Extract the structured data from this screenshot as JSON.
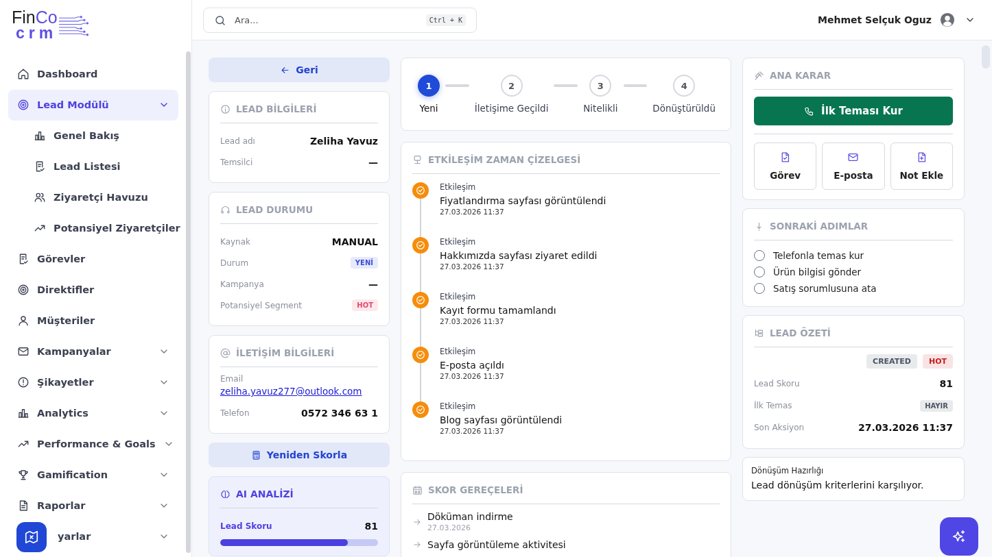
{
  "logo": {
    "dark": "Fin",
    "accent": "Co",
    "sub": "crm"
  },
  "sidebar": {
    "items": [
      {
        "label": "Dashboard",
        "selected": false,
        "expandable": false
      },
      {
        "label": "Lead Modülü",
        "selected": true,
        "expandable": true,
        "expanded": true,
        "children": [
          {
            "label": "Genel Bakış"
          },
          {
            "label": "Lead Listesi"
          },
          {
            "label": "Ziyaretçi Havuzu"
          },
          {
            "label": "Potansiyel Ziyaretçiler"
          }
        ]
      },
      {
        "label": "Görevler",
        "selected": false,
        "expandable": false
      },
      {
        "label": "Direktifler",
        "selected": false,
        "expandable": false
      },
      {
        "label": "Müşteriler",
        "selected": false,
        "expandable": false
      },
      {
        "label": "Kampanyalar",
        "selected": false,
        "expandable": true
      },
      {
        "label": "Şikayetler",
        "selected": false,
        "expandable": true
      },
      {
        "label": "Analytics",
        "selected": false,
        "expandable": true
      },
      {
        "label": "Performance & Goals",
        "selected": false,
        "expandable": true
      },
      {
        "label": "Gamification",
        "selected": false,
        "expandable": true
      },
      {
        "label": "Raporlar",
        "selected": false,
        "expandable": true
      },
      {
        "label": "yarlar",
        "selected": false,
        "expandable": true
      }
    ]
  },
  "search": {
    "placeholder": "Ara...",
    "shortcut": "Ctrl + K"
  },
  "user": {
    "name": "Mehmet Selçuk Oguz"
  },
  "back_button": "Geri",
  "lead_info": {
    "title": "LEAD BİLGİLERİ",
    "rows": [
      {
        "label": "Lead adı",
        "value": "Zeliha Yavuz",
        "kind": "text"
      },
      {
        "label": "Temsilci",
        "value": "—",
        "kind": "text"
      }
    ]
  },
  "lead_status": {
    "title": "LEAD DURUMU",
    "rows": [
      {
        "label": "Kaynak",
        "value": "MANUAL",
        "kind": "text"
      },
      {
        "label": "Durum",
        "value": "YENİ",
        "kind": "badge",
        "color": "#3b4fd8"
      },
      {
        "label": "Kampanya",
        "value": "—",
        "kind": "text"
      },
      {
        "label": "Potansiyel Segment",
        "value": "HOT",
        "kind": "badge",
        "color": "#e5486f"
      }
    ]
  },
  "contact": {
    "title": "İLETİŞİM BİLGİLERİ",
    "email_label": "Email",
    "email": "zeliha.yavuz277@outlook.com",
    "phone_label": "Telefon",
    "phone": "0572 346 63 1"
  },
  "rescore_button": "Yeniden Skorla",
  "ai_analysis": {
    "title": "AI ANALİZİ",
    "label": "Lead Skoru",
    "score": "81",
    "level": 0.81
  },
  "stepper": {
    "steps": [
      {
        "number": "1",
        "label": "Yeni",
        "selected": true
      },
      {
        "number": "2",
        "label": "İletişime Geçildi",
        "selected": false
      },
      {
        "number": "3",
        "label": "Nitelikli",
        "selected": false
      },
      {
        "number": "4",
        "label": "Dönüştürüldü",
        "selected": false
      }
    ]
  },
  "timeline": {
    "title": "ETKİLEŞİM ZAMAN ÇİZELGESİ",
    "events": [
      {
        "type": "Etkileşim",
        "title": "Fiyatlandırma sayfası görüntülendi",
        "time": "27.03.2026 11:37"
      },
      {
        "type": "Etkileşim",
        "title": "Hakkımızda sayfası ziyaret edildi",
        "time": "27.03.2026 11:37"
      },
      {
        "type": "Etkileşim",
        "title": "Kayıt formu tamamlandı",
        "time": "27.03.2026 11:37"
      },
      {
        "type": "Etkileşim",
        "title": "E-posta açıldı",
        "time": "27.03.2026 11:37"
      },
      {
        "type": "Etkileşim",
        "title": "Blog sayfası görüntülendi",
        "time": "27.03.2026 11:37"
      }
    ]
  },
  "score_reasons": {
    "title": "SKOR GEREÇELERİ",
    "items": [
      {
        "title": "Döküman indirme",
        "date": "27.03.2026"
      },
      {
        "title": "Sayfa görüntüleme aktivitesi"
      }
    ]
  },
  "main_decision": {
    "title": "ANA KARAR",
    "primary_button": "İlk Teması Kur",
    "actions": [
      {
        "label": "Görev"
      },
      {
        "label": "E-posta"
      },
      {
        "label": "Not Ekle"
      }
    ]
  },
  "next_steps": {
    "title": "SONRAKİ ADIMLAR",
    "items": [
      {
        "label": "Telefonla temas kur",
        "checked": false
      },
      {
        "label": "Ürün bilgisi gönder",
        "checked": false
      },
      {
        "label": "Satış sorumlusuna ata",
        "checked": false
      }
    ]
  },
  "lead_summary": {
    "title": "LEAD ÖZETİ",
    "tags": [
      {
        "text": "CREATED",
        "color": "#4b5563"
      },
      {
        "text": "HOT",
        "color": "#c81e1e"
      }
    ],
    "rows": [
      {
        "label": "Lead Skoru",
        "value": "81",
        "kind": "text"
      },
      {
        "label": "İlk Temas",
        "value": "HAYIR",
        "kind": "badge",
        "color": "#4b5563"
      },
      {
        "label": "Son Aksiyon",
        "value": "27.03.2026 11:37",
        "kind": "text"
      }
    ]
  },
  "conversion": {
    "title": "Dönüşüm Hazırlığı",
    "text": "Lead dönüşüm kriterlerini karşılıyor."
  }
}
